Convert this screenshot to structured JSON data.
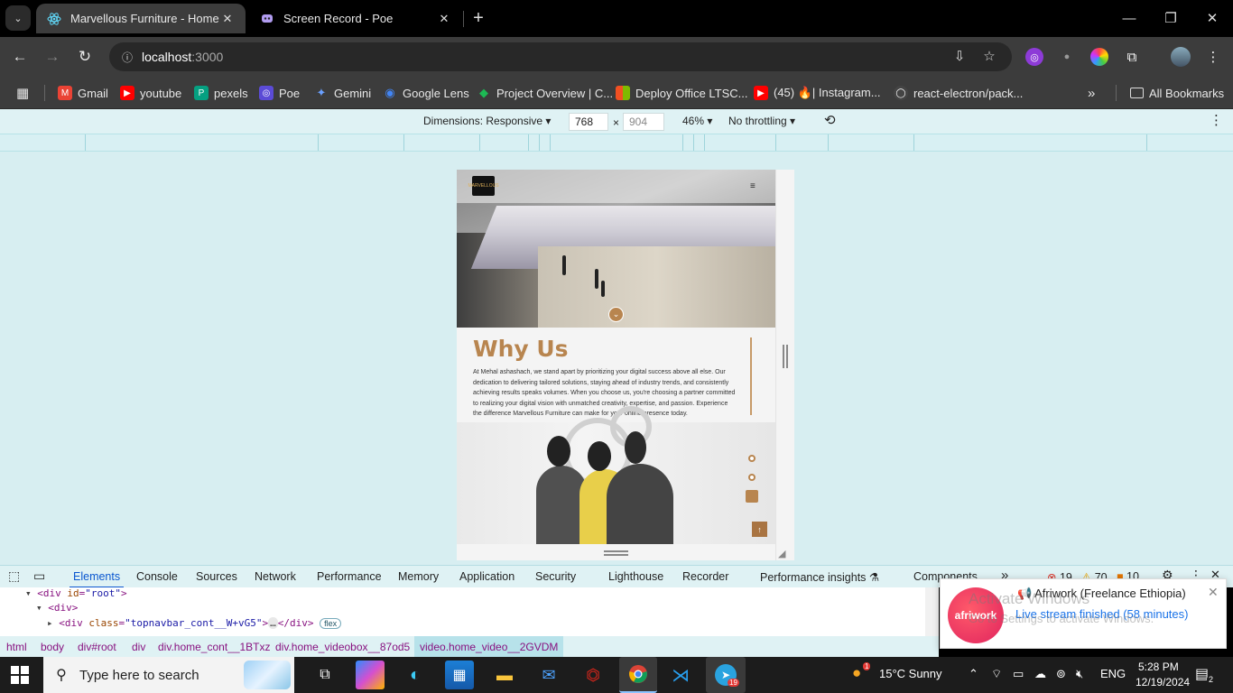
{
  "browser": {
    "tabs": [
      {
        "title": "Marvellous Furniture - Home",
        "active": true
      },
      {
        "title": "Screen Record - Poe",
        "active": false
      }
    ],
    "new_tab": "+",
    "url_host": "localhost",
    "url_port": ":3000",
    "bookmarks": [
      {
        "label": "Gmail",
        "color": "#ea4335",
        "icon": "M"
      },
      {
        "label": "youtube",
        "color": "#ff0000",
        "icon": "▶"
      },
      {
        "label": "pexels",
        "color": "#05a081",
        "icon": "P"
      },
      {
        "label": "Poe",
        "color": "#5b4bd6",
        "icon": "◎"
      },
      {
        "label": "Gemini",
        "color": "#4a8af4",
        "icon": "✦"
      },
      {
        "label": "Google Lens",
        "color": "#4285f4",
        "icon": "◉"
      },
      {
        "label": "Project Overview | C...",
        "color": "#1db954",
        "icon": "◆"
      },
      {
        "label": "Deploy Office LTSC...",
        "color": "#f25022",
        "icon": "▦"
      },
      {
        "label": "(45) 🔥| Instagram...",
        "color": "#ff0000",
        "icon": "▶"
      },
      {
        "label": "react-electron/pack...",
        "color": "#444",
        "icon": "◯"
      }
    ],
    "all_bookmarks": "All Bookmarks",
    "overflow": "»"
  },
  "device_toolbar": {
    "dimensions_label": "Dimensions: Responsive",
    "width": "768",
    "times": "×",
    "height": "904",
    "zoom": "46%",
    "throttling": "No throttling"
  },
  "site": {
    "logo_text": "MARVELLOUS",
    "hamburger": "≡",
    "why_title": "Why Us",
    "why_text": "At Mehal ashashach, we stand apart by prioritizing your digital success above all else. Our dedication to delivering tailored solutions, staying ahead of industry trends, and consistently achieving results speaks volumes. When you choose us, you're choosing a partner committed to realizing your digital vision with unmatched creativity, expertise, and passion. Experience the difference Marvellous Furniture can make for your online presence today.",
    "scroll_down": "⌄",
    "to_top": "↑"
  },
  "devtools": {
    "tabs": [
      "Elements",
      "Console",
      "Sources",
      "Network",
      "Performance",
      "Memory",
      "Application",
      "Security",
      "Lighthouse",
      "Recorder",
      "Performance insights",
      "Components"
    ],
    "more": "»",
    "errors": "19",
    "warnings": "70",
    "issues": "10",
    "tree": {
      "line1_tag": "<div ",
      "line1_attr": "id",
      "line1_val": "\"root\"",
      "line1_end": ">",
      "line2": "<div>",
      "line3_tag": "<div ",
      "line3_attr": "class",
      "line3_val": "\"topnavbar_cont__W+vG5\"",
      "line3_end": ">",
      "line3_ellipsis": "…",
      "line3_close": "</div>",
      "flex_badge": "flex"
    },
    "breadcrumbs": [
      "html",
      "body",
      "div#root",
      "div",
      "div.home_cont__1BTxz",
      "div.home_videobox__87od5",
      "video.home_video__2GVDM"
    ]
  },
  "notification": {
    "logo_text": "afriwork",
    "title": "📢 Afriwork (Freelance Ethiopia)",
    "body": "Live stream finished (58 minutes)",
    "close": "✕"
  },
  "watermark": {
    "line1": "Activate Windows",
    "line2": "Go to Settings to activate Windows."
  },
  "taskbar": {
    "search_placeholder": "Type here to search",
    "weather": "15°C  Sunny",
    "language": "ENG",
    "time": "5:28 PM",
    "date": "12/19/2024",
    "notifications_count": "2",
    "telegram_badge": "19",
    "weather_badge": "1"
  }
}
